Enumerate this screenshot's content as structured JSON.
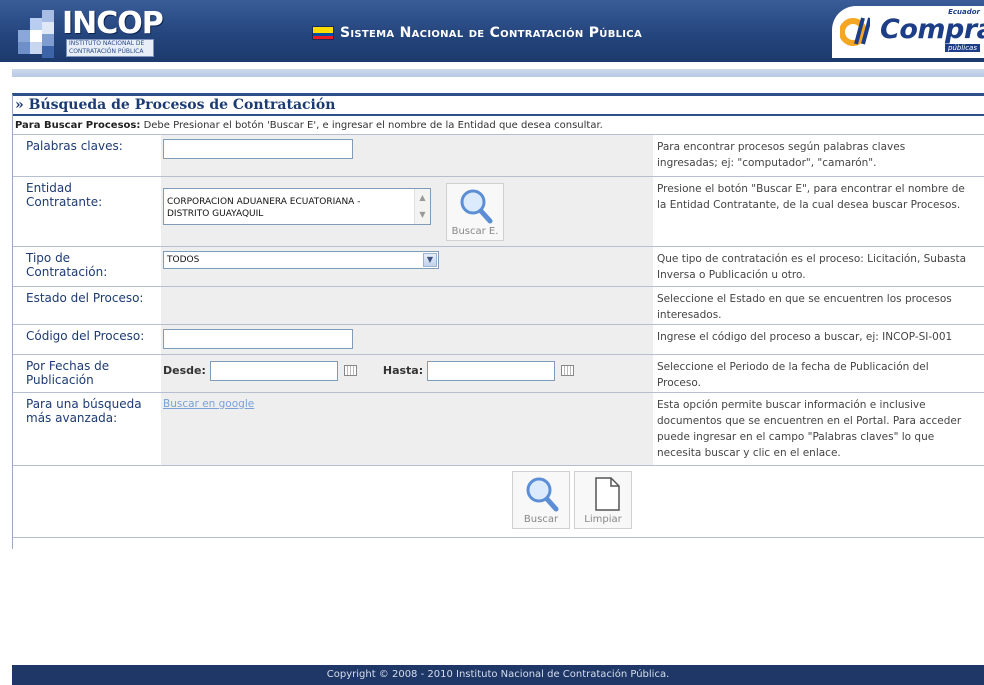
{
  "header": {
    "incop_logo_text": "INCOP",
    "incop_logo_subtitle": "Instituto Nacional de Contratación Pública",
    "system_title": "Sistema Nacional de Contratación Pública",
    "compras_logo_text": "Compras",
    "compras_logo_top": "Ecuador",
    "compras_logo_bottom": "públicas"
  },
  "page": {
    "title": "» Búsqueda de Procesos de Contratación",
    "instructions_bold": "Para Buscar Procesos:",
    "instructions_text": "Debe Presionar el botón 'Buscar E', e ingresar el nombre de la Entidad que desea consultar."
  },
  "form": {
    "keywords": {
      "label": "Palabras claves:",
      "value": "",
      "help_line1": "Para encontrar procesos según palabras claves",
      "help_line2": "ingresadas; ej: \"computador\", \"camarón\"."
    },
    "entity": {
      "label_line1": "Entidad",
      "label_line2": "Contratante:",
      "value_line1": "CORPORACION ADUANERA ECUATORIANA -",
      "value_line2": "DISTRITO GUAYAQUIL",
      "search_button_label": "Buscar E.",
      "help_line1": "Presione el botón \"Buscar E\", para encontrar el nombre de",
      "help_line2": "la Entidad Contratante, de la cual desea buscar Procesos."
    },
    "contract_type": {
      "label_line1": "Tipo de",
      "label_line2": "Contratación:",
      "selected": "TODOS",
      "help_line1": "Que tipo de contratación es el proceso: Licitación, Subasta",
      "help_line2": "Inversa o Publicación u otro."
    },
    "process_status": {
      "label": "Estado del Proceso:",
      "help_line1": "Seleccione el Estado en que se encuentren los procesos",
      "help_line2": "interesados."
    },
    "process_code": {
      "label": "Código del Proceso:",
      "value": "",
      "help_line1": "Ingrese el código del proceso a buscar, ej: INCOP-SI-001"
    },
    "publication_dates": {
      "label_line1": "Por Fechas de",
      "label_line2": "Publicación",
      "from_label": "Desde:",
      "from_value": "",
      "to_label": "Hasta:",
      "to_value": "",
      "help_line1": "Seleccione el Periodo de la fecha de Publicación del",
      "help_line2": "Proceso."
    },
    "advanced": {
      "label_line1": "Para una búsqueda",
      "label_line2": "más avanzada:",
      "link_text": "Buscar en google",
      "help_line1": "Esta opción permite buscar información e inclusive",
      "help_line2": "documentos que se encuentren en el Portal. Para acceder",
      "help_line3": "puede ingresar en el campo \"Palabras claves\" lo que",
      "help_line4": "necesita buscar y clic en el enlace."
    }
  },
  "actions": {
    "search_label": "Buscar",
    "clear_label": "Limpiar"
  },
  "footer": {
    "copyright": "Copyright © 2008 - 2010 Instituto Nacional de Contratación Pública."
  },
  "colors": {
    "header_blue": "#24457d",
    "title_blue": "#1d3b73",
    "link_blue": "#7aa2d6",
    "footer_blue": "#1e3766"
  }
}
